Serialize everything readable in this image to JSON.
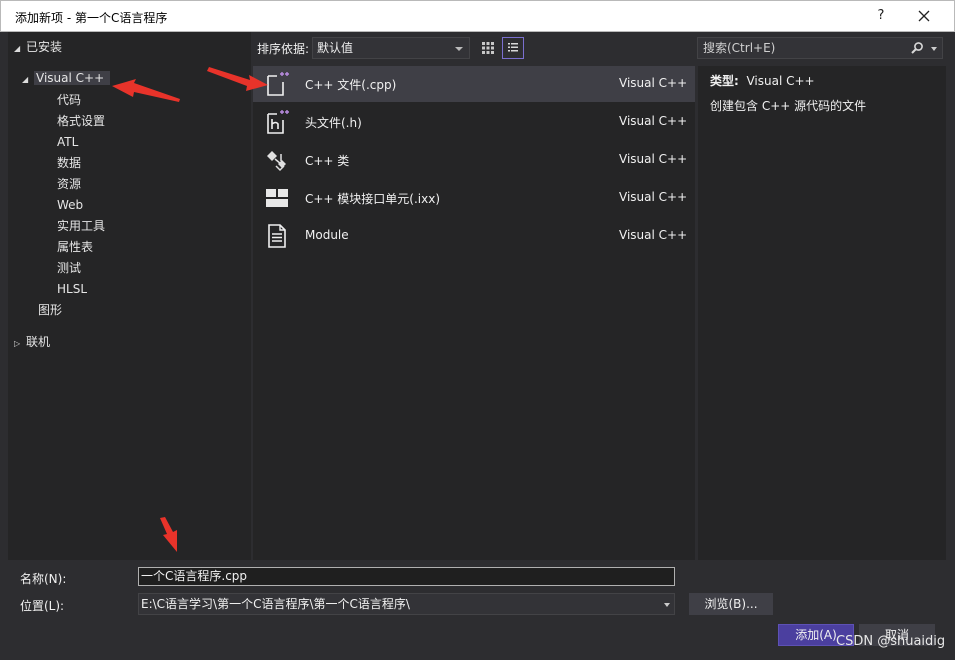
{
  "window": {
    "title": "添加新项 - 第一个C语言程序",
    "help": "?"
  },
  "tree": {
    "installed": "已安装",
    "visual_cpp": "Visual C++",
    "children": [
      "代码",
      "格式设置",
      "ATL",
      "数据",
      "资源",
      "Web",
      "实用工具",
      "属性表",
      "测试",
      "HLSL"
    ],
    "graphics": "图形",
    "online": "联机"
  },
  "toolbar": {
    "sort_label": "排序依据:",
    "sort_value": "默认值"
  },
  "search": {
    "placeholder": "搜索(Ctrl+E)"
  },
  "templates": [
    {
      "name": "C++ 文件(.cpp)",
      "type": "Visual C++",
      "icon": "cpp-file-icon"
    },
    {
      "name": "头文件(.h)",
      "type": "Visual C++",
      "icon": "header-file-icon"
    },
    {
      "name": "C++ 类",
      "type": "Visual C++",
      "icon": "class-icon"
    },
    {
      "name": "C++ 模块接口单元(.ixx)",
      "type": "Visual C++",
      "icon": "module-interface-icon"
    },
    {
      "name": "Module",
      "type": "Visual C++",
      "icon": "module-document-icon"
    }
  ],
  "details": {
    "type_label": "类型:",
    "type_value": "Visual C++",
    "description": "创建包含 C++ 源代码的文件"
  },
  "form": {
    "name_label": "名称(N):",
    "name_value": "一个C语言程序.cpp",
    "location_label": "位置(L):",
    "location_value": "E:\\C语言学习\\第一个C语言程序\\第一个C语言程序\\",
    "browse": "浏览(B)...",
    "add": "添加(A)",
    "cancel": "取消"
  },
  "watermark": "CSDN @shuaidig",
  "colors": {
    "background": "#2d2d30",
    "panel": "#252526",
    "selection": "#3f3f46",
    "accent": "#4b3f9f",
    "annotation_red": "#e8332a"
  }
}
